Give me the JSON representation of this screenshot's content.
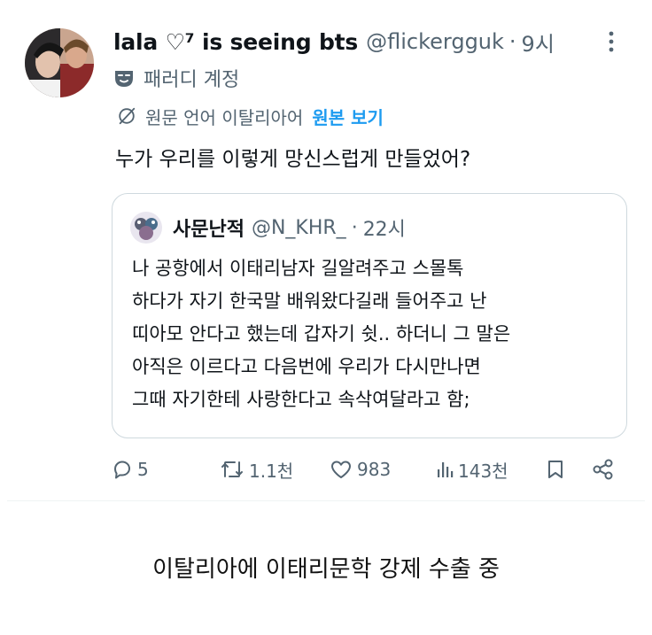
{
  "tweet": {
    "display_name": "lala ♡⁷ is seeing bts",
    "handle": "@flickergguk",
    "separator": "·",
    "time": "9시",
    "parody_label": "패러디 계정",
    "translation": {
      "label": "원문 언어 이탈리아어",
      "show_original": "원본 보기"
    },
    "text": "누가 우리를 이렇게 망신스럽게 만들었어?"
  },
  "quote": {
    "display_name": "사문난적",
    "handle": "@N_KHR_",
    "separator": "·",
    "time": "22시",
    "lines": [
      "나 공항에서 이태리남자 길알려주고 스몰톡",
      "하다가 자기 한국말 배워왔다길래 들어주고 난",
      "띠아모 안다고 했는데 갑자기 쉿.. 하더니 그 말은",
      "아직은 이르다고 다음번에 우리가 다시만나면",
      "그때 자기한테 사랑한다고 속삭여달라고 함;"
    ]
  },
  "actions": {
    "replies": "5",
    "retweets": "1.1천",
    "likes": "983",
    "views": "143천"
  },
  "caption": "이탈리아에 이태리문학 강제 수출 중",
  "colors": {
    "text_primary": "#0f1419",
    "text_secondary": "#536471",
    "link": "#1d9bf0",
    "border": "#cfd9de"
  },
  "icons": {
    "more": "more-vertical-icon",
    "parody": "theater-mask-icon",
    "translate": "globe-slash-icon",
    "reply": "reply-icon",
    "retweet": "retweet-icon",
    "like": "heart-icon",
    "views": "views-bar-icon",
    "bookmark": "bookmark-icon",
    "share": "share-icon"
  }
}
